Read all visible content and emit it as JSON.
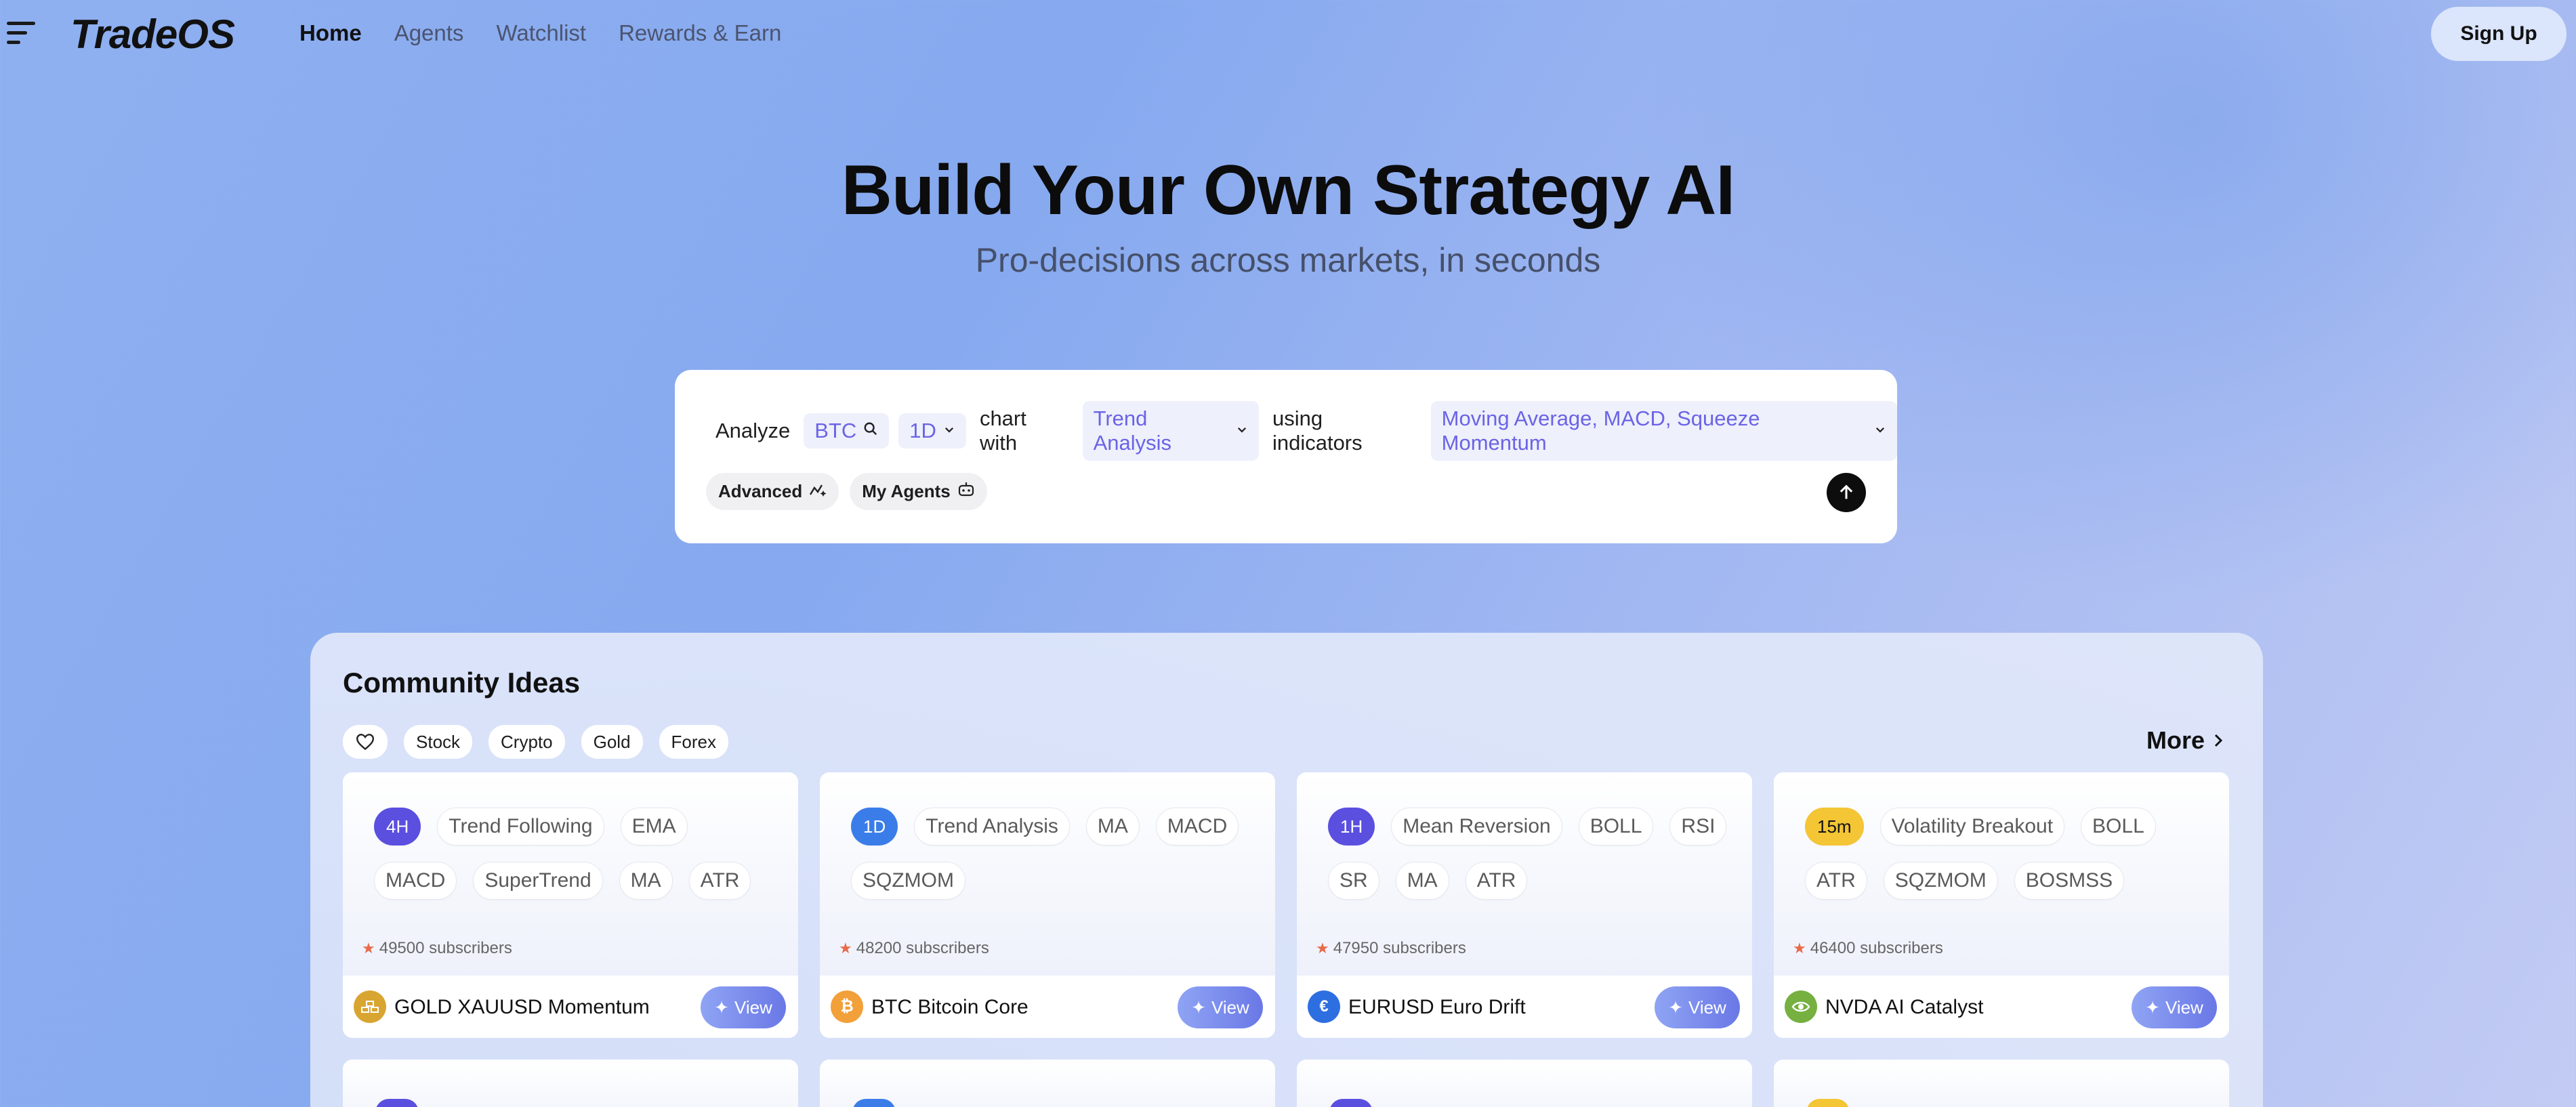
{
  "nav": {
    "logo": "TradeOS",
    "links": [
      "Home",
      "Agents",
      "Watchlist",
      "Rewards & Earn"
    ],
    "signup": "Sign Up"
  },
  "hero": {
    "title": "Build Your Own Strategy AI",
    "subtitle": "Pro-decisions across markets, in seconds"
  },
  "prompt": {
    "analyze": "Analyze",
    "symbol": "BTC",
    "timeframe": "1D",
    "chart_with": "chart with",
    "analysis": "Trend Analysis",
    "using_indicators": "using indicators",
    "indicators": "Moving Average, MACD, Squeeze Momentum",
    "advanced": "Advanced",
    "my_agents": "My Agents"
  },
  "community": {
    "title": "Community Ideas",
    "filters": [
      "Stock",
      "Crypto",
      "Gold",
      "Forex"
    ],
    "more": "More",
    "cards": [
      {
        "timeframe": "4H",
        "tf_color": "#5b4fe0",
        "tags": [
          "Trend Following",
          "EMA",
          "MACD",
          "SuperTrend",
          "MA",
          "ATR"
        ],
        "subscribers": "49500 subscribers",
        "name": "GOLD XAUUSD Momentum",
        "icon": "gold-coin-icon",
        "icon_color": "#d9a531",
        "view": "View"
      },
      {
        "timeframe": "1D",
        "tf_color": "#3a7de8",
        "tags": [
          "Trend Analysis",
          "MA",
          "MACD",
          "SQZMOM"
        ],
        "subscribers": "48200 subscribers",
        "name": "BTC Bitcoin Core",
        "icon": "bitcoin-icon",
        "icon_color": "#f2a03a",
        "view": "View"
      },
      {
        "timeframe": "1H",
        "tf_color": "#5b4fe0",
        "tags": [
          "Mean Reversion",
          "BOLL",
          "RSI",
          "SR",
          "MA",
          "ATR"
        ],
        "subscribers": "47950 subscribers",
        "name": "EURUSD Euro Drift",
        "icon": "euro-icon",
        "icon_color": "#2d6fe0",
        "view": "View"
      },
      {
        "timeframe": "15m",
        "tf_color": "#f4c534",
        "tags": [
          "Volatility Breakout",
          "BOLL",
          "ATR",
          "SQZMOM",
          "BOSMSS"
        ],
        "subscribers": "46400 subscribers",
        "name": "NVDA AI Catalyst",
        "icon": "nvidia-icon",
        "icon_color": "#76b041",
        "view": "View"
      }
    ]
  }
}
